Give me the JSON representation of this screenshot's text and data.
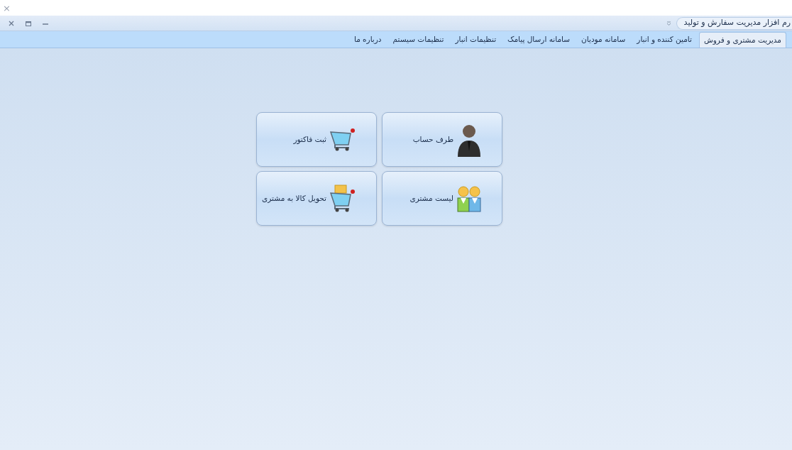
{
  "window": {
    "close_glyph": "×",
    "title": "رم افزار مدیریت سفارش و تولید"
  },
  "tabs": [
    {
      "label": "مدیریت مشتری و فروش",
      "selected": true
    },
    {
      "label": "تامین کننده و انبار",
      "selected": false
    },
    {
      "label": "سامانه مودیان",
      "selected": false
    },
    {
      "label": "سامانه ارسال پیامک",
      "selected": false
    },
    {
      "label": "تنظیمات انبار",
      "selected": false
    },
    {
      "label": "تنظیمات سیستم",
      "selected": false
    },
    {
      "label": "درباره ما",
      "selected": false
    }
  ],
  "tiles": [
    {
      "label": "طرف حساب",
      "kind": "person"
    },
    {
      "label": "ثبت فاکتور",
      "kind": "cart"
    },
    {
      "label": "لیست مشتری",
      "kind": "people"
    },
    {
      "label": "تحویل کالا به مشتری",
      "kind": "delivery"
    }
  ]
}
